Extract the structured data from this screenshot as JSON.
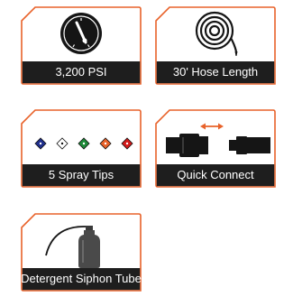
{
  "colors": {
    "accent": "#e8622a",
    "label_bg": "#1e1e1e",
    "icon_dark": "#151515",
    "tip_colors": [
      "#1f2f8c",
      "#ffffff",
      "#1f8a3a",
      "#e8622a",
      "#d11a1a"
    ]
  },
  "features": [
    {
      "label": "3,200 PSI",
      "icon": "pressure-gauge-icon"
    },
    {
      "label": "30' Hose Length",
      "icon": "hose-coil-icon"
    },
    {
      "label": "5 Spray Tips",
      "icon": "spray-tips-icon"
    },
    {
      "label": "Quick Connect",
      "icon": "quick-connect-icon"
    },
    {
      "label": "Detergent Siphon Tube",
      "icon": "detergent-bottle-icon"
    }
  ]
}
